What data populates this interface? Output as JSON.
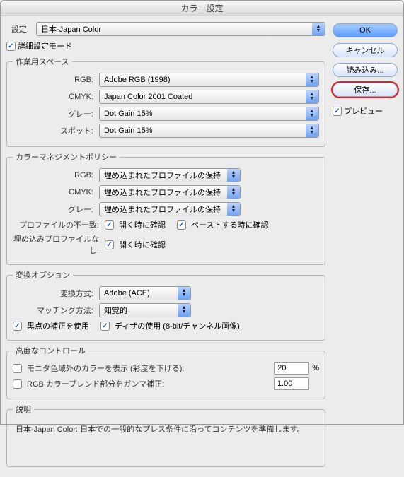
{
  "title": "カラー設定",
  "settings": {
    "label": "設定:",
    "value": "日本-Japan Color"
  },
  "advanced": {
    "label": "詳細設定モード"
  },
  "workspace": {
    "legend": "作業用スペース",
    "rgb": {
      "label": "RGB:",
      "value": "Adobe RGB (1998)"
    },
    "cmyk": {
      "label": "CMYK:",
      "value": "Japan Color 2001 Coated"
    },
    "gray": {
      "label": "グレー:",
      "value": "Dot Gain 15%"
    },
    "spot": {
      "label": "スポット:",
      "value": "Dot Gain 15%"
    }
  },
  "policy": {
    "legend": "カラーマネジメントポリシー",
    "rgb": {
      "label": "RGB:",
      "value": "埋め込まれたプロファイルの保持"
    },
    "cmyk": {
      "label": "CMYK:",
      "value": "埋め込まれたプロファイルの保持"
    },
    "gray": {
      "label": "グレー:",
      "value": "埋め込まれたプロファイルの保持"
    },
    "mismatch": {
      "label": "プロファイルの不一致:",
      "open": "開く時に確認",
      "paste": "ペーストする時に確認"
    },
    "missing": {
      "label": "埋め込みプロファイルなし:",
      "open": "開く時に確認"
    }
  },
  "convert": {
    "legend": "変換オプション",
    "engine": {
      "label": "変換方式:",
      "value": "Adobe (ACE)"
    },
    "intent": {
      "label": "マッチング方法:",
      "value": "知覚的"
    },
    "blackpoint": "黒点の補正を使用",
    "dither": "ディザの使用 (8-bit/チャンネル画像)"
  },
  "advctrl": {
    "legend": "高度なコントロール",
    "desat": {
      "label": "モニタ色域外のカラーを表示 (彩度を下げる):",
      "value": "20",
      "unit": "%"
    },
    "blend": {
      "label": "RGB カラーブレンド部分をガンマ補正:",
      "value": "1.00"
    }
  },
  "description": {
    "legend": "説明",
    "text": "日本-Japan Color:  日本での一般的なプレス条件に沿ってコンテンツを準備します。"
  },
  "buttons": {
    "ok": "OK",
    "cancel": "キャンセル",
    "load": "読み込み...",
    "save": "保存...",
    "preview": "プレビュー"
  }
}
